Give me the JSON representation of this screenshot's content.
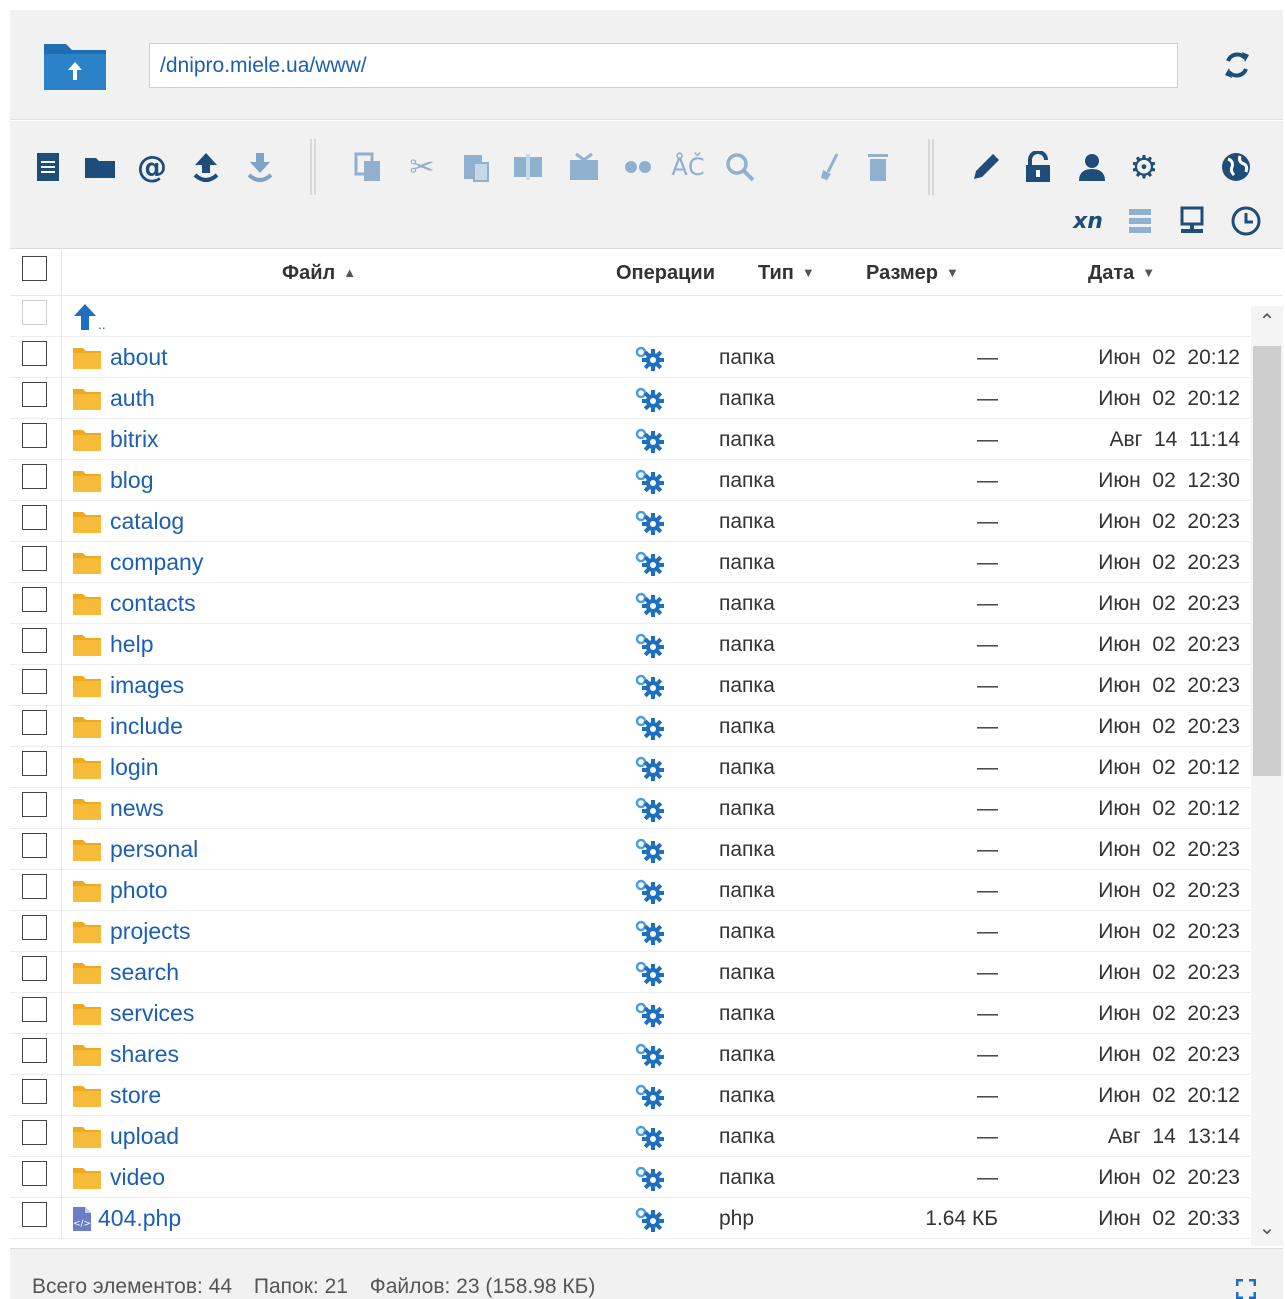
{
  "path": {
    "value": "/dnipro.miele.ua/www/"
  },
  "toolbar": {
    "translit_label": "xn",
    "icons": [
      "new-file-icon",
      "new-folder-icon",
      "email-icon",
      "upload-icon",
      "download-icon",
      "copy-icon",
      "cut-icon",
      "paste-icon",
      "archive-icon",
      "extract-icon",
      "duplicate-icon",
      "rename-case-icon",
      "search-icon",
      "clear-icon",
      "delete-icon",
      "edit-icon",
      "permissions-icon",
      "user-icon",
      "settings-icon",
      "globe-icon",
      "list-view-icon",
      "computer-icon",
      "history-icon"
    ]
  },
  "header": {
    "file": "Файл",
    "operations": "Операции",
    "type": "Тип",
    "size": "Размер",
    "date": "Дата"
  },
  "parent_label": "..",
  "rows": [
    {
      "name": "about",
      "type": "папка",
      "size": "—",
      "date": "Июн  02  20:12"
    },
    {
      "name": "auth",
      "type": "папка",
      "size": "—",
      "date": "Июн  02  20:12"
    },
    {
      "name": "bitrix",
      "type": "папка",
      "size": "—",
      "date": "Авг  14  11:14"
    },
    {
      "name": "blog",
      "type": "папка",
      "size": "—",
      "date": "Июн  02  12:30"
    },
    {
      "name": "catalog",
      "type": "папка",
      "size": "—",
      "date": "Июн  02  20:23"
    },
    {
      "name": "company",
      "type": "папка",
      "size": "—",
      "date": "Июн  02  20:23"
    },
    {
      "name": "contacts",
      "type": "папка",
      "size": "—",
      "date": "Июн  02  20:23"
    },
    {
      "name": "help",
      "type": "папка",
      "size": "—",
      "date": "Июн  02  20:23"
    },
    {
      "name": "images",
      "type": "папка",
      "size": "—",
      "date": "Июн  02  20:23"
    },
    {
      "name": "include",
      "type": "папка",
      "size": "—",
      "date": "Июн  02  20:23"
    },
    {
      "name": "login",
      "type": "папка",
      "size": "—",
      "date": "Июн  02  20:12"
    },
    {
      "name": "news",
      "type": "папка",
      "size": "—",
      "date": "Июн  02  20:12"
    },
    {
      "name": "personal",
      "type": "папка",
      "size": "—",
      "date": "Июн  02  20:23"
    },
    {
      "name": "photo",
      "type": "папка",
      "size": "—",
      "date": "Июн  02  20:23"
    },
    {
      "name": "projects",
      "type": "папка",
      "size": "—",
      "date": "Июн  02  20:23"
    },
    {
      "name": "search",
      "type": "папка",
      "size": "—",
      "date": "Июн  02  20:23"
    },
    {
      "name": "services",
      "type": "папка",
      "size": "—",
      "date": "Июн  02  20:23"
    },
    {
      "name": "shares",
      "type": "папка",
      "size": "—",
      "date": "Июн  02  20:23"
    },
    {
      "name": "store",
      "type": "папка",
      "size": "—",
      "date": "Июн  02  20:12"
    },
    {
      "name": "upload",
      "type": "папка",
      "size": "—",
      "date": "Авг  14  13:14"
    },
    {
      "name": "video",
      "type": "папка",
      "size": "—",
      "date": "Июн  02  20:23"
    },
    {
      "name": "404.php",
      "type": "php",
      "size": "1.64 КБ",
      "date": "Июн  02  20:33",
      "kind": "file"
    }
  ],
  "status": {
    "total": "Всего элементов: 44",
    "folders": "Папок: 21",
    "files": "Файлов: 23 (158.98 КБ)"
  },
  "colors": {
    "accent": "#1a5fb4",
    "folder": "#f5b12a",
    "icon_dark": "#1e4d7a"
  }
}
